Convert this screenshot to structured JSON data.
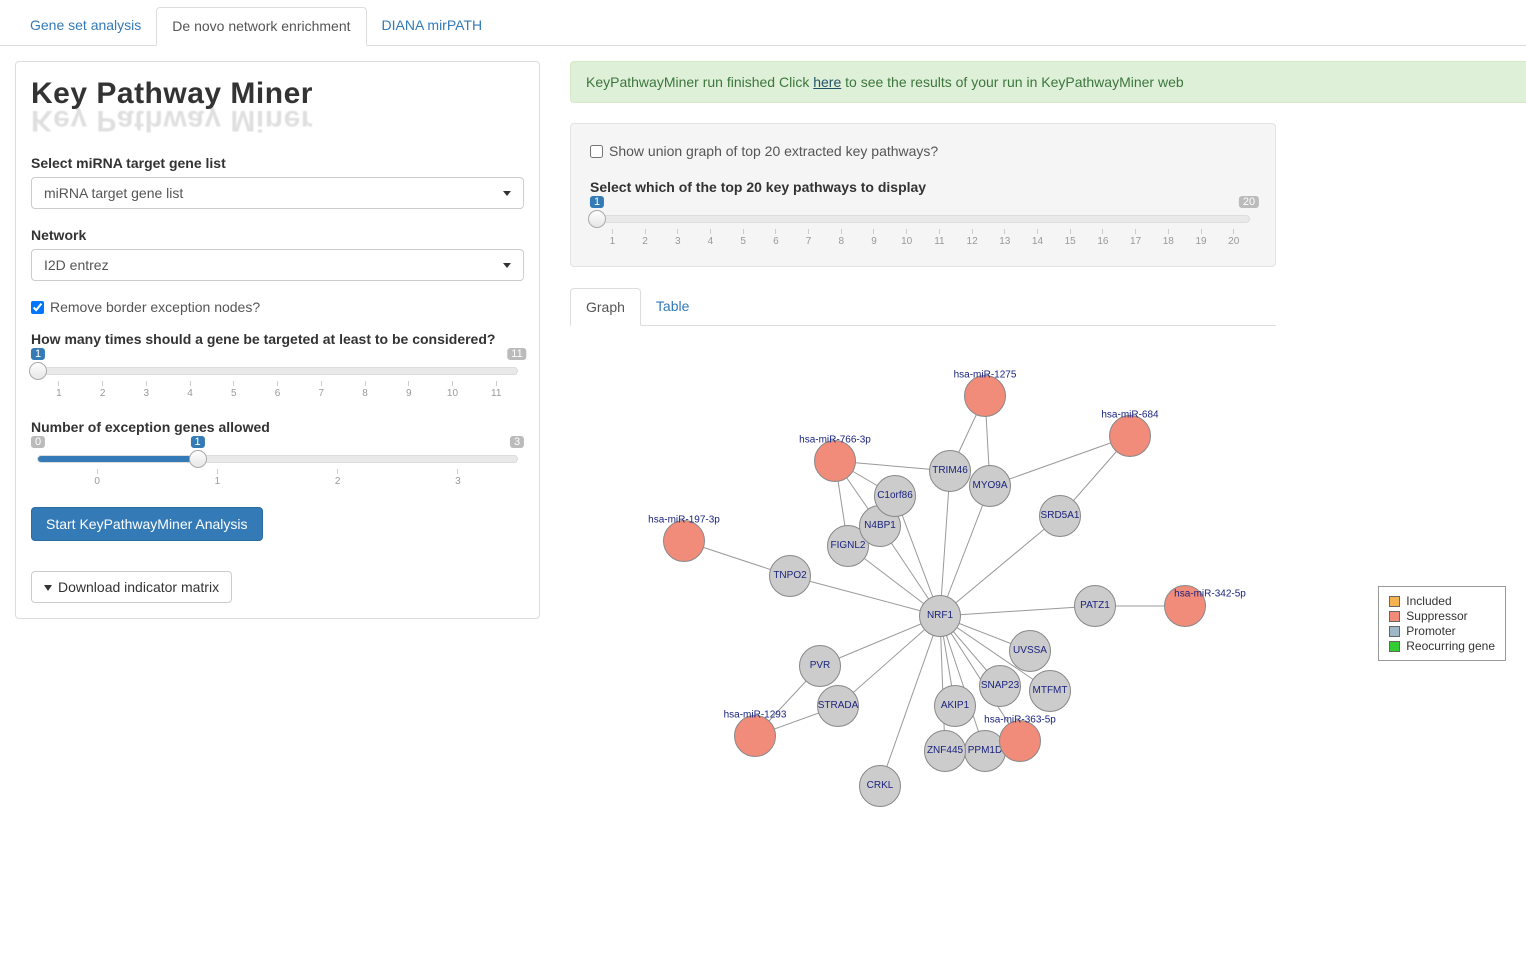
{
  "tabs": {
    "gene_set": "Gene set analysis",
    "denovo": "De novo network enrichment",
    "diana": "DIANA mirPATH"
  },
  "logo": "Key Pathway Miner",
  "left": {
    "select_label": "Select miRNA target gene list",
    "select_value": "miRNA target gene list",
    "network_label": "Network",
    "network_value": "I2D entrez",
    "remove_border_label": "Remove border exception nodes?",
    "slider1_label": "How many times should a gene be targeted at least to be considered?",
    "slider2_label": "Number of exception genes allowed",
    "btn_start": "Start KeyPathwayMiner Analysis",
    "btn_download": "Download indicator matrix"
  },
  "alert": {
    "prefix": "KeyPathwayMiner run finished Click ",
    "link": "here",
    "suffix": " to see the results of your run in KeyPathwayMiner web"
  },
  "control": {
    "union_label": "Show union graph of top 20 extracted key pathways?",
    "select_label": "Select which of the top 20 key pathways to display"
  },
  "graph_tabs": {
    "graph": "Graph",
    "table": "Table"
  },
  "legend": {
    "included": "Included",
    "suppressor": "Suppressor",
    "promoter": "Promoter",
    "reocurring": "Reocurring gene"
  },
  "slider1": {
    "min": 1,
    "max": 11,
    "value": 1
  },
  "slider2": {
    "min": 0,
    "max": 3,
    "value": 1
  },
  "slider3": {
    "min": 1,
    "max": 20,
    "value": 1
  },
  "nodes": {
    "NRF1": "NRF1",
    "TNPO2": "TNPO2",
    "FIGNL2": "FIGNL2",
    "N4BP1": "N4BP1",
    "C1orf86": "C1orf86",
    "TRIM46": "TRIM46",
    "MYO9A": "MYO9A",
    "SRD5A1": "SRD5A1",
    "PATZ1": "PATZ1",
    "UVSSA": "UVSSA",
    "SNAP23": "SNAP23",
    "MTFMT": "MTFMT",
    "AKIP1": "AKIP1",
    "PPM1D": "PPM1D",
    "ZNF445": "ZNF445",
    "CRKL": "CRKL",
    "STRADA": "STRADA",
    "PVR": "PVR",
    "m197": "hsa-miR-197-3p",
    "m766": "hsa-miR-766-3p",
    "m1275": "hsa-miR-1275",
    "m684": "hsa-miR-684",
    "m342": "hsa-miR-342-5p",
    "m363": "hsa-miR-363-5p",
    "m1293": "hsa-miR-1293"
  }
}
